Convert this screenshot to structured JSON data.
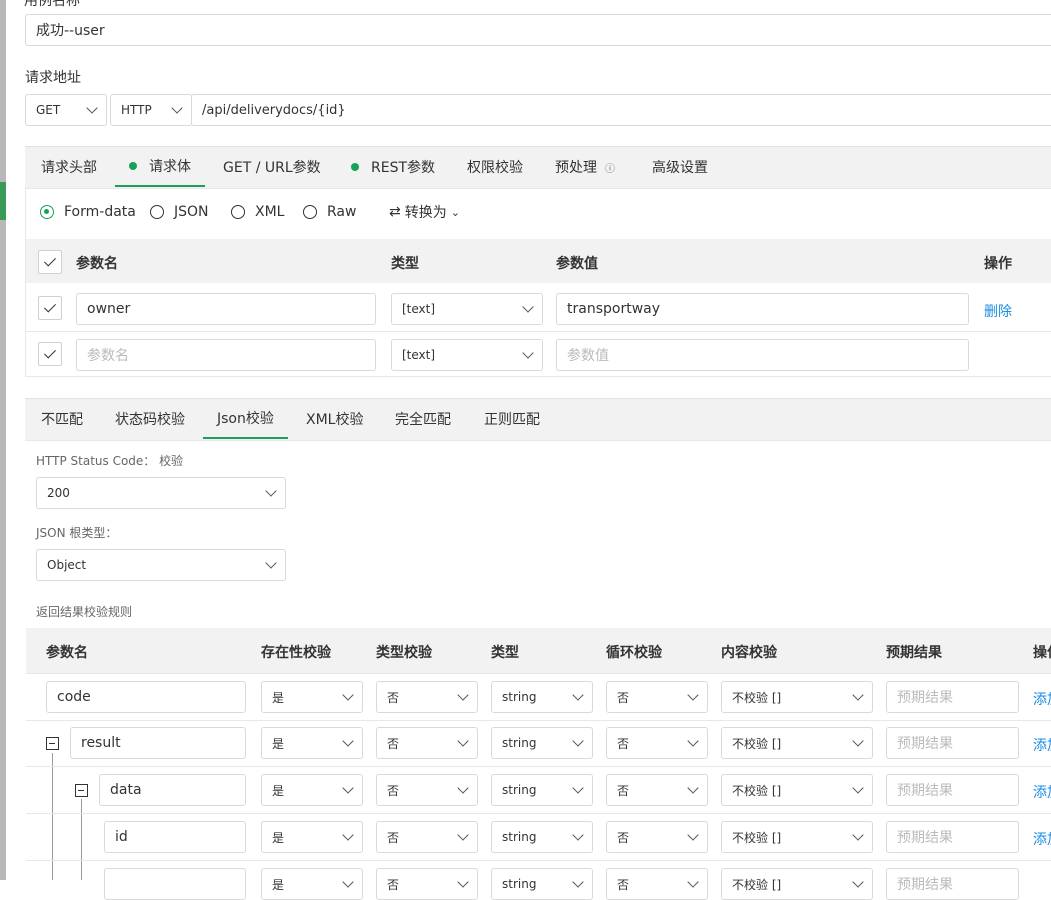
{
  "top": {
    "cut_label": "用例名称",
    "case_name_value": "成功--user",
    "url_label": "请求地址",
    "method": "GET",
    "protocol": "HTTP",
    "path": "/api/deliverydocs/{id}"
  },
  "request_tabs": [
    {
      "label": "请求头部",
      "dot": false,
      "active": false
    },
    {
      "label": "请求体",
      "dot": true,
      "active": true
    },
    {
      "label": "GET / URL参数",
      "dot": false,
      "active": false
    },
    {
      "label": "REST参数",
      "dot": true,
      "active": false
    },
    {
      "label": "权限校验",
      "dot": false,
      "active": false
    },
    {
      "label": "预处理",
      "dot": false,
      "active": false,
      "icon": "info-icon"
    },
    {
      "label": "高级设置",
      "dot": false,
      "active": false
    }
  ],
  "body_types": {
    "options": [
      "Form-data",
      "JSON",
      "XML",
      "Raw"
    ],
    "selected": "Form-data",
    "convert_label": "转换为"
  },
  "params_table": {
    "headers": {
      "name": "参数名",
      "type": "类型",
      "value": "参数值",
      "action": "操作"
    },
    "rows": [
      {
        "name": "owner",
        "type": "[text]",
        "value": "transportway",
        "action": "删除"
      },
      {
        "name_placeholder": "参数名",
        "type": "[text]",
        "value_placeholder": "参数值"
      }
    ]
  },
  "assert_tabs": [
    {
      "label": "不匹配",
      "active": false
    },
    {
      "label": "状态码校验",
      "active": false
    },
    {
      "label": "Json校验",
      "active": true
    },
    {
      "label": "XML校验",
      "active": false
    },
    {
      "label": "完全匹配",
      "active": false
    },
    {
      "label": "正则匹配",
      "active": false
    }
  ],
  "json_check": {
    "status_code_label": "HTTP Status Code：  校验",
    "status_code_value": "200",
    "root_type_label": "JSON 根类型：",
    "root_type_value": "Object",
    "rules_label": "返回结果校验规则"
  },
  "rules_table": {
    "headers": [
      "参数名",
      "存在性校验",
      "类型校验",
      "类型",
      "循环校验",
      "内容校验",
      "预期结果",
      "操作"
    ],
    "expected_placeholder": "预期结果",
    "rows": [
      {
        "name": "code",
        "exist": "是",
        "type_check": "否",
        "type": "string",
        "loop": "否",
        "content": "不校验 []",
        "action": "添加"
      },
      {
        "name": "result",
        "exist": "是",
        "type_check": "否",
        "type": "string",
        "loop": "否",
        "content": "不校验 []",
        "action": "添加"
      },
      {
        "name": "data",
        "exist": "是",
        "type_check": "否",
        "type": "string",
        "loop": "否",
        "content": "不校验 []",
        "action": "添加"
      },
      {
        "name": "id",
        "exist": "是",
        "type_check": "否",
        "type": "string",
        "loop": "否",
        "content": "不校验 []",
        "action": "添加"
      },
      {
        "name": "",
        "exist": "是",
        "type_check": "否",
        "type": "string",
        "loop": "否",
        "content": "不校验 []",
        "action": ""
      }
    ]
  },
  "colors": {
    "accent": "#19a05a",
    "link": "#1a8de0"
  }
}
